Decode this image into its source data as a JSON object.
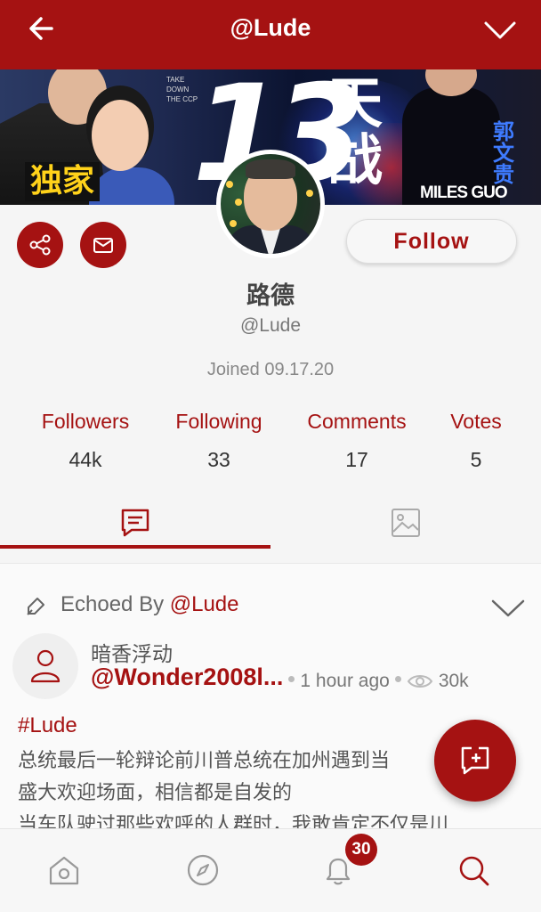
{
  "header": {
    "title": "@Lude",
    "back_icon": "arrow-left-icon",
    "menu_icon": "chevron-down-icon"
  },
  "banner": {
    "badge_text": "独家",
    "small_text": "TAKE DOWN THE CCP",
    "headline_number": "13",
    "headline_chars": "天战",
    "caption": "MILES GUO",
    "vertical_name": "郭文贵"
  },
  "profile": {
    "display_name": "路德",
    "handle": "@Lude",
    "joined": "Joined 09.17.20",
    "follow_label": "Follow",
    "stats": [
      {
        "label": "Followers",
        "value": "44k"
      },
      {
        "label": "Following",
        "value": "33"
      },
      {
        "label": "Comments",
        "value": "17"
      },
      {
        "label": "Votes",
        "value": "5"
      }
    ]
  },
  "tabs": [
    {
      "name": "posts",
      "icon": "posts-icon",
      "active": true
    },
    {
      "name": "media",
      "icon": "image-icon",
      "active": false
    }
  ],
  "post": {
    "echoed_prefix": "Echoed By ",
    "echoed_handle": "@Lude",
    "author_name": "暗香浮动",
    "author_handle": "@Wonder2008l...",
    "time": "1 hour ago",
    "views": "30k",
    "hashtag": "#Lude",
    "body_lines": [
      "总统最后一轮辩论前川普总统在加州遇到当",
      "盛大欢迎场面，相信都是自发的",
      "当车队驶过那些欢呼的人群时，我敢肯定不仅是川"
    ]
  },
  "bottom_nav": {
    "items": [
      "home",
      "explore",
      "notifications",
      "search"
    ],
    "notification_count": "30"
  },
  "colors": {
    "brand": "#a51212",
    "background": "#f5f5f5"
  }
}
